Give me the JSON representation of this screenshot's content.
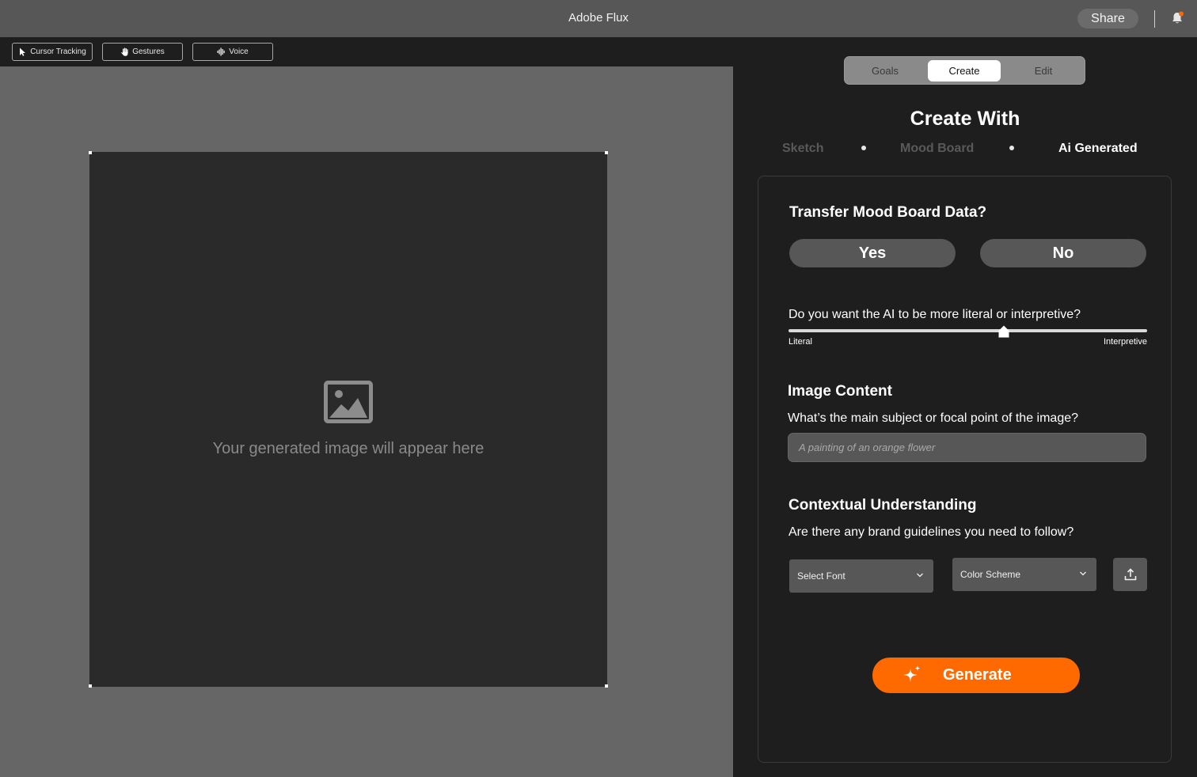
{
  "app": {
    "title": "Adobe Flux",
    "share_label": "Share",
    "notification_dot_color": "#ff6a00"
  },
  "toolbar": {
    "cursor_tracking_label": "Cursor Tracking",
    "gestures_label": "Gestures",
    "voice_label": "Voice"
  },
  "canvas": {
    "placeholder_text": "Your generated image will appear here",
    "placeholder_icon": "image-icon"
  },
  "panel": {
    "tabs": [
      {
        "label": "Goals",
        "active": false
      },
      {
        "label": "Create",
        "active": true
      },
      {
        "label": "Edit",
        "active": false
      }
    ],
    "heading": "Create With",
    "steps": [
      {
        "label": "Sketch",
        "active": false
      },
      {
        "label": "Mood Board",
        "active": false
      },
      {
        "label": "Ai Generated",
        "active": true
      }
    ],
    "transfer": {
      "title": "Transfer Mood Board Data?",
      "yes_label": "Yes",
      "no_label": "No"
    },
    "interpretation": {
      "question": "Do you want the AI to be more literal or interpretive?",
      "min_label": "Literal",
      "max_label": "Interpretive",
      "value_fraction": 0.6
    },
    "image_content": {
      "title": "Image Content",
      "question": "What’s the main subject or focal point of the image?",
      "placeholder": "A painting of an orange flower"
    },
    "context": {
      "title": "Contextual Understanding",
      "question": "Are there any brand guidelines you need to follow?",
      "font_select": "Select Font",
      "color_select": "Color Scheme"
    },
    "generate_label": "Generate",
    "accent_color": "#ff6a00"
  }
}
